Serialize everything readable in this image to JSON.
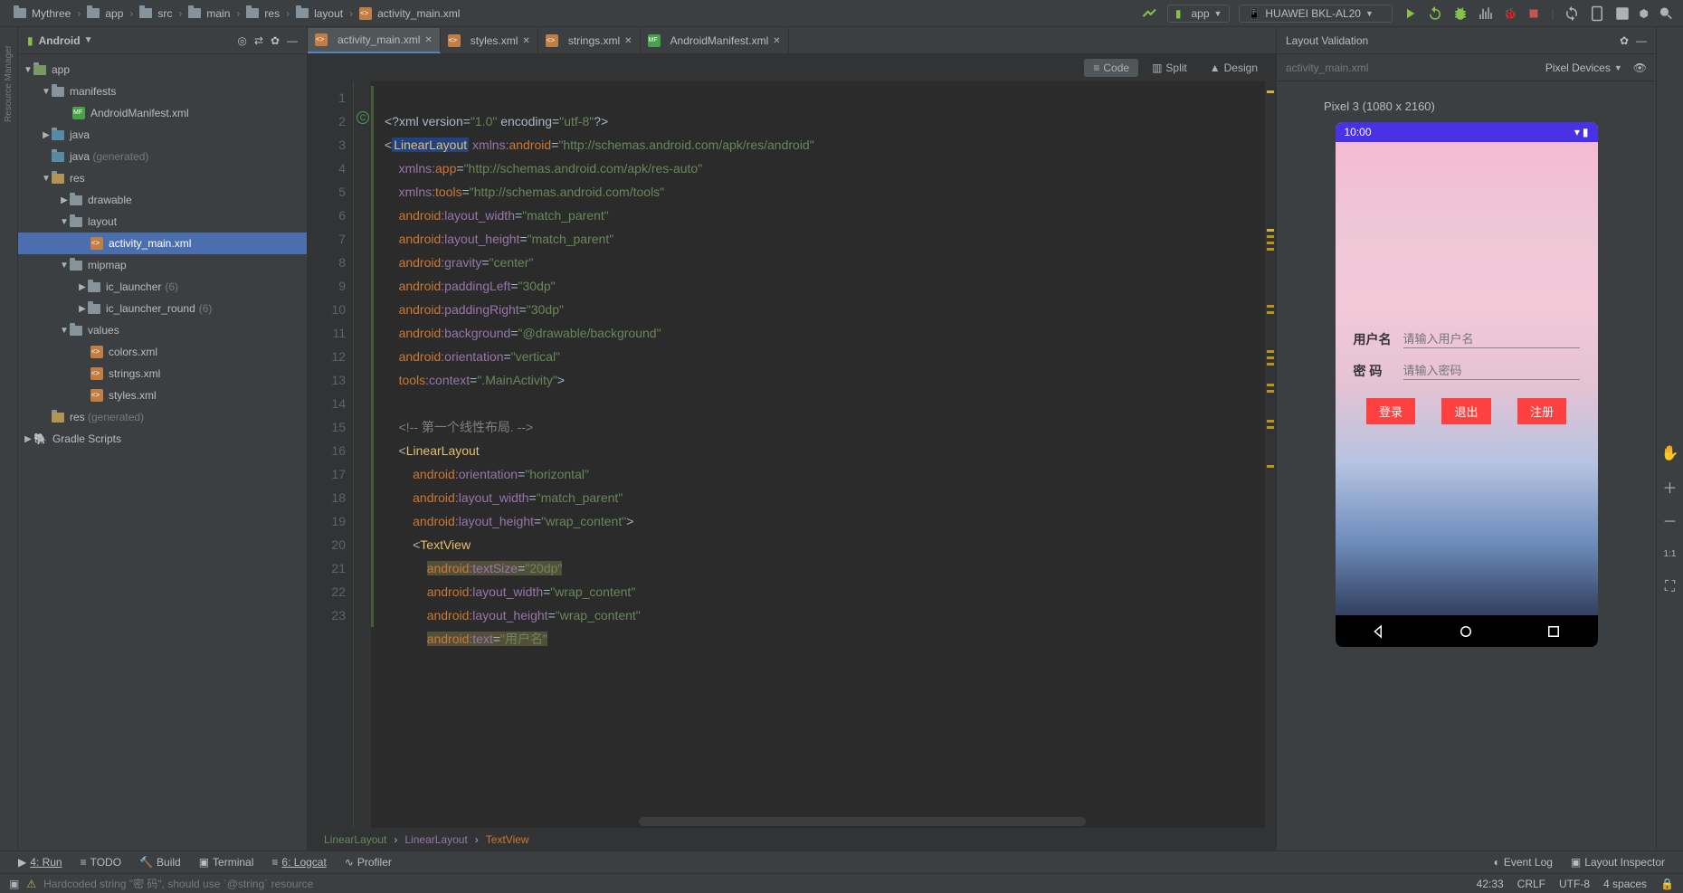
{
  "breadcrumbs": [
    "Mythree",
    "app",
    "src",
    "main",
    "res",
    "layout",
    "activity_main.xml"
  ],
  "run_configs": {
    "app": "app",
    "device": "HUAWEI BKL-AL20"
  },
  "project_panel": {
    "title": "Android",
    "tree": {
      "app": "app",
      "manifests": "manifests",
      "manifest_file": "AndroidManifest.xml",
      "java": "java",
      "java_gen": "java",
      "gen_suffix": "(generated)",
      "res": "res",
      "drawable": "drawable",
      "layout": "layout",
      "activity_main": "activity_main.xml",
      "mipmap": "mipmap",
      "ic_launcher": "ic_launcher",
      "ic_launcher_count": "(6)",
      "ic_launcher_round": "ic_launcher_round",
      "ic_round_count": "(6)",
      "values": "values",
      "colors": "colors.xml",
      "strings": "strings.xml",
      "styles": "styles.xml",
      "res_gen": "res",
      "gradle": "Gradle Scripts"
    }
  },
  "editor_tabs": [
    {
      "label": "activity_main.xml",
      "active": true,
      "type": "xml"
    },
    {
      "label": "styles.xml",
      "active": false,
      "type": "xml"
    },
    {
      "label": "strings.xml",
      "active": false,
      "type": "xml"
    },
    {
      "label": "AndroidManifest.xml",
      "active": false,
      "type": "mf"
    }
  ],
  "view_modes": {
    "code": "Code",
    "split": "Split",
    "design": "Design"
  },
  "code_breadcrumb": [
    "LinearLayout",
    "LinearLayout",
    "TextView"
  ],
  "right_panel": {
    "title": "Layout Validation",
    "filename": "activity_main.xml",
    "device_dd": "Pixel Devices",
    "preview_title": "Pixel 3 (1080 x 2160)",
    "time": "10:00",
    "form": {
      "user_label": "用户名",
      "user_ph": "请输入用户名",
      "pwd_label": "密   码",
      "pwd_ph": "请输入密码",
      "btn_login": "登录",
      "btn_exit": "退出",
      "btn_register": "注册"
    }
  },
  "bottom": {
    "run": "4: Run",
    "todo": "TODO",
    "build": "Build",
    "terminal": "Terminal",
    "logcat": "6: Logcat",
    "profiler": "Profiler",
    "eventlog": "Event Log",
    "inspector": "Layout Inspector"
  },
  "status": {
    "msg": "Hardcoded string \"密  码\", should use `@string` resource",
    "pos": "42:33",
    "eol": "CRLF",
    "enc": "UTF-8",
    "indent": "4 spaces"
  }
}
